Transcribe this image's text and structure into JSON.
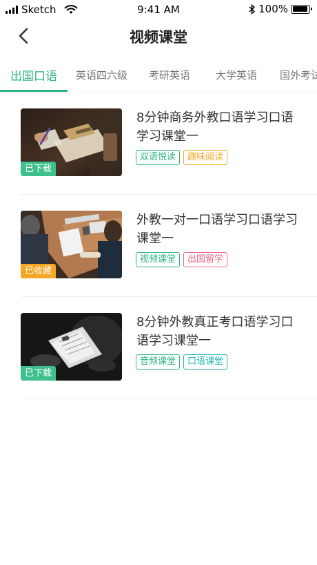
{
  "status": {
    "carrier": "Sketch",
    "time": "9:41 AM",
    "battery": "100%"
  },
  "header": {
    "title": "视频课堂",
    "back_icon": "chevron-left-icon"
  },
  "tabs": [
    {
      "label": "出国口语",
      "active": true
    },
    {
      "label": "英语四六级",
      "active": false
    },
    {
      "label": "考研英语",
      "active": false
    },
    {
      "label": "大学英语",
      "active": false
    },
    {
      "label": "国外考试",
      "active": false
    }
  ],
  "courses": [
    {
      "title": "8分钟商务外教口语学习口语学习课堂一",
      "badge": "已下载",
      "badge_color": "#3fbf8c",
      "tags": [
        {
          "label": "双语悦读",
          "color": "#2db580"
        },
        {
          "label": "趣味阅读",
          "color": "#f5a623"
        }
      ]
    },
    {
      "title": "外教一对一口语学习口语学习课堂一",
      "badge": "已收藏",
      "badge_color": "#f5a623",
      "tags": [
        {
          "label": "视频课堂",
          "color": "#2db580"
        },
        {
          "label": "出国留学",
          "color": "#e8637f"
        }
      ]
    },
    {
      "title": "8分钟外教真正考口语学习口语学习课堂一",
      "badge": "已下载",
      "badge_color": "#3fbf8c",
      "tags": [
        {
          "label": "音频课堂",
          "color": "#2db580"
        },
        {
          "label": "口语课堂",
          "color": "#1fb5b8"
        }
      ]
    }
  ],
  "colors": {
    "accent": "#2db580"
  }
}
